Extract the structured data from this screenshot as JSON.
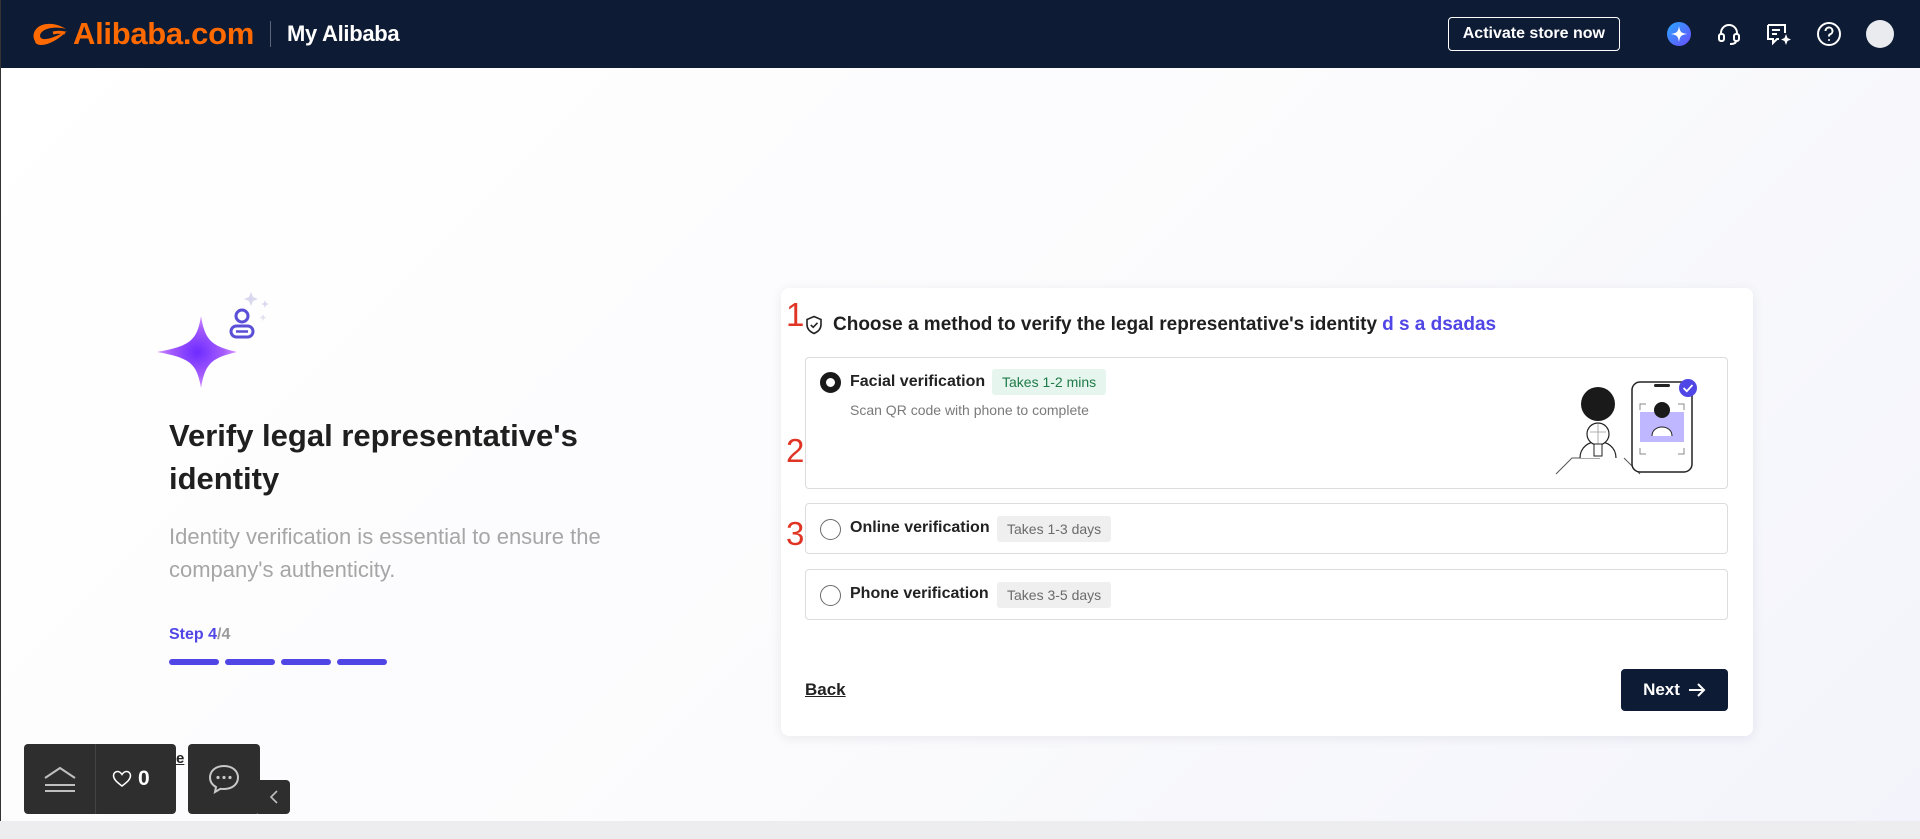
{
  "header": {
    "logo_text": "Alibaba.com",
    "section_title": "My Alibaba",
    "activate_label": "Activate store now",
    "icons": [
      "ai-assistant-icon",
      "customer-service-icon",
      "messages-icon",
      "help-icon",
      "avatar"
    ]
  },
  "intro": {
    "title": "Verify legal representative's identity",
    "subtitle": "Identity verification is essential to ensure the company's authenticity.",
    "step_prefix": "Step ",
    "step_current": "4",
    "step_total": "/4",
    "progress": {
      "completed": 4,
      "total": 4
    }
  },
  "card": {
    "heading": "Choose a method to verify the legal representative's identity",
    "person_name": "d s a dsadas",
    "options": [
      {
        "marker": "1",
        "label": "Facial verification",
        "badge": "Takes 1-2 mins",
        "description": "Scan QR code with phone to complete",
        "selected": true
      },
      {
        "marker": "2",
        "label": "Online verification",
        "badge": "Takes 1-3 days",
        "selected": false
      },
      {
        "marker": "3",
        "label": "Phone verification",
        "badge": "Takes 3-5 days",
        "selected": false
      }
    ],
    "back_label": "Back",
    "next_label": "Next"
  },
  "floating": {
    "favorites_count": "0",
    "hidden_link_fragment": "e"
  },
  "colors": {
    "header_bg": "#0d1b35",
    "brand_orange": "#ff6a00",
    "accent_purple": "#5046e5",
    "marker_red": "#e03524"
  }
}
